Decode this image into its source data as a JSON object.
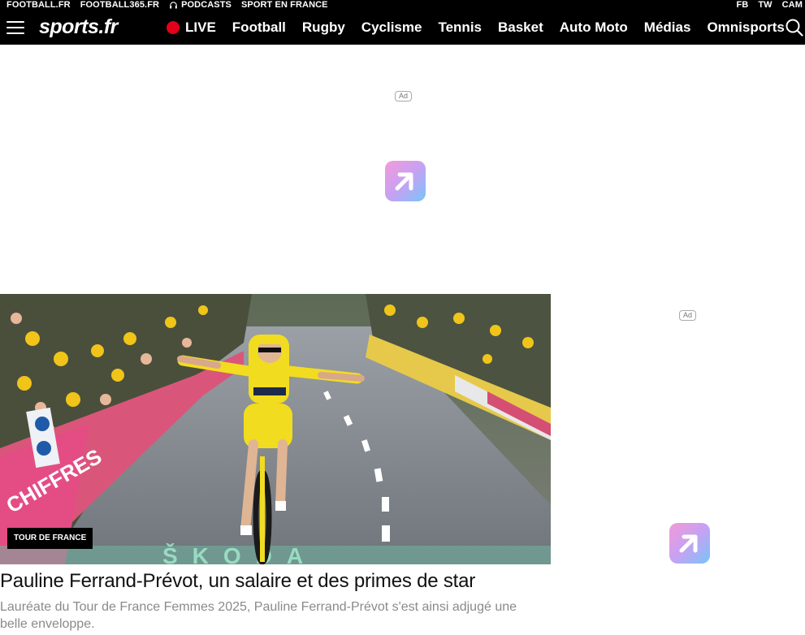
{
  "topbar": {
    "links": [
      "FOOTBALL.FR",
      "FOOTBALL365.FR",
      "PODCASTS",
      "SPORT EN FRANCE"
    ],
    "social": [
      "FB",
      "TW",
      "CAM"
    ]
  },
  "nav": {
    "logo": "sports.fr",
    "live_label": "LIVE",
    "items": [
      "Football",
      "Rugby",
      "Cyclisme",
      "Tennis",
      "Basket",
      "Auto Moto",
      "Médias",
      "Omnisports"
    ]
  },
  "ads": {
    "top_badge": "Ad",
    "side_badge": "Ad"
  },
  "article": {
    "category": "TOUR DE FRANCE",
    "title": "Pauline Ferrand-Prévot, un salaire et des primes de star",
    "description": "Lauréate du Tour de France Femmes 2025, Pauline Ferrand-Prévot s'est ainsi adjugé une belle enveloppe.",
    "image_banner_text": "ŠKODA",
    "sign_text": "CHIFFRES"
  },
  "colors": {
    "bar_bg": "#000000",
    "live_dot": "#e3001b",
    "jersey": "#f2dc1f",
    "ad_gradient_start": "#f39ad8",
    "ad_gradient_end": "#79c4f8"
  }
}
